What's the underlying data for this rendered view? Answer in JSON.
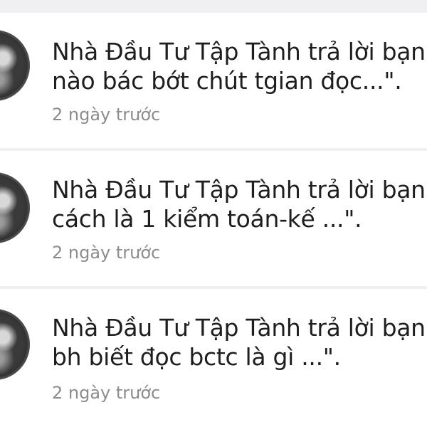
{
  "notifications": [
    {
      "line1": "Nhà Đầu Tư Tập Tành trả lời bạn \"h",
      "line2": "nào bác bớt chút tgian đọc...\".",
      "time": "2 ngày trước"
    },
    {
      "line1": "Nhà Đầu Tư Tập Tành trả lời bạn \"v",
      "line2": "cách là 1 kiểm toán-kế ...\".",
      "time": "2 ngày trước"
    },
    {
      "line1": "Nhà Đầu Tư Tập Tành trả lời bạn \"b",
      "line2": "bh biết đọc bctc là gì ...\".",
      "time": "2 ngày trước"
    }
  ]
}
